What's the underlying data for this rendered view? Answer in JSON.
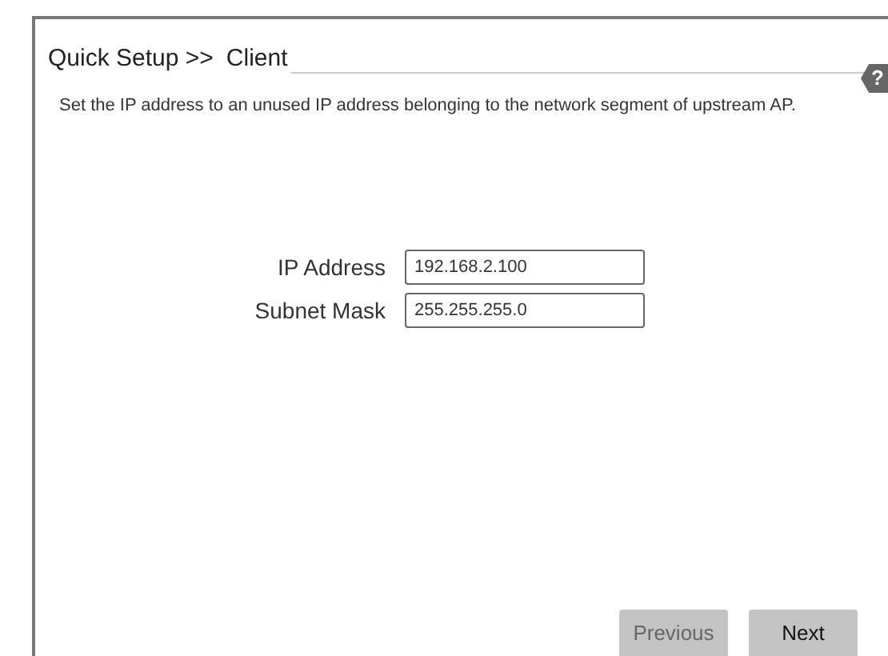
{
  "title": {
    "section": "Quick Setup >>",
    "page": "Client"
  },
  "help": {
    "label": "?"
  },
  "description": "Set the IP address to an unused IP address belonging to the network segment of upstream AP.",
  "fields": [
    {
      "label": "IP Address",
      "value": "192.168.2.100"
    },
    {
      "label": "Subnet Mask",
      "value": "255.255.255.0"
    }
  ],
  "buttons": [
    {
      "label": "Previous",
      "disabled": true
    },
    {
      "label": "Next",
      "disabled": false
    }
  ]
}
